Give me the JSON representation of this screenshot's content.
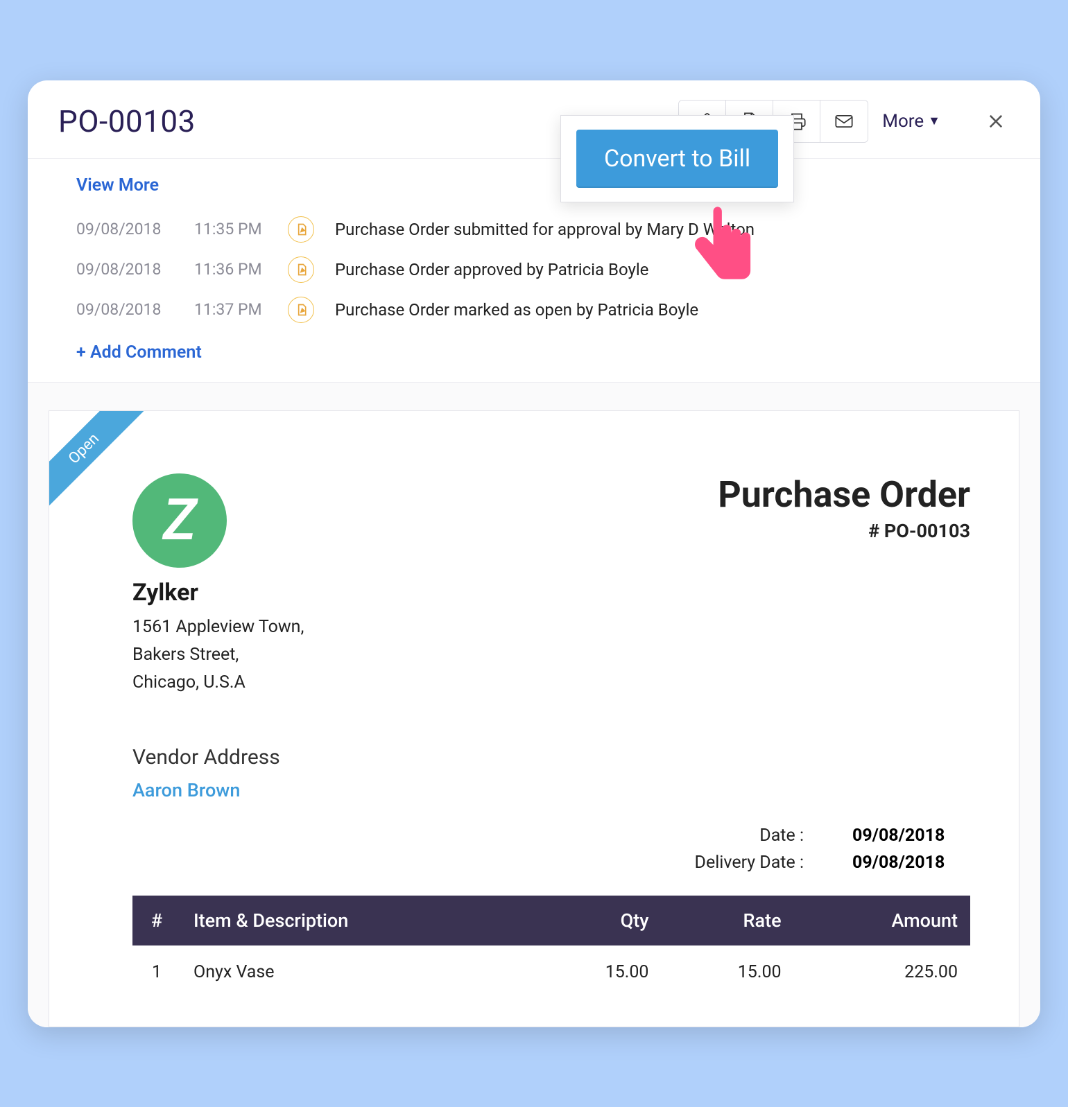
{
  "header": {
    "title": "PO-00103",
    "more_label": "More",
    "convert_label": "Convert to Bill"
  },
  "activity": {
    "view_more": "View More",
    "add_comment": "+  Add Comment",
    "items": [
      {
        "date": "09/08/2018",
        "time": "11:35 PM",
        "text": "Purchase Order submitted for approval by Mary D Walton"
      },
      {
        "date": "09/08/2018",
        "time": "11:36 PM",
        "text": "Purchase Order approved by Patricia Boyle"
      },
      {
        "date": "09/08/2018",
        "time": "11:37 PM",
        "text": "Purchase Order marked as open by Patricia Boyle"
      }
    ]
  },
  "document": {
    "status_ribbon": "Open",
    "logo_letter": "Z",
    "company": "Zylker",
    "address": {
      "line1": "1561 Appleview Town,",
      "line2": "Bakers Street,",
      "line3": "Chicago, U.S.A"
    },
    "title": "Purchase Order",
    "number_label": "# PO-00103",
    "vendor_heading": "Vendor Address",
    "vendor_name": "Aaron Brown",
    "meta": {
      "date_label": "Date :",
      "date_value": "09/08/2018",
      "delivery_label": "Delivery Date :",
      "delivery_value": "09/08/2018"
    },
    "columns": {
      "num": "#",
      "item": "Item & Description",
      "qty": "Qty",
      "rate": "Rate",
      "amount": "Amount"
    },
    "rows": [
      {
        "n": "1",
        "item": "Onyx Vase",
        "qty": "15.00",
        "rate": "15.00",
        "amount": "225.00"
      }
    ]
  }
}
